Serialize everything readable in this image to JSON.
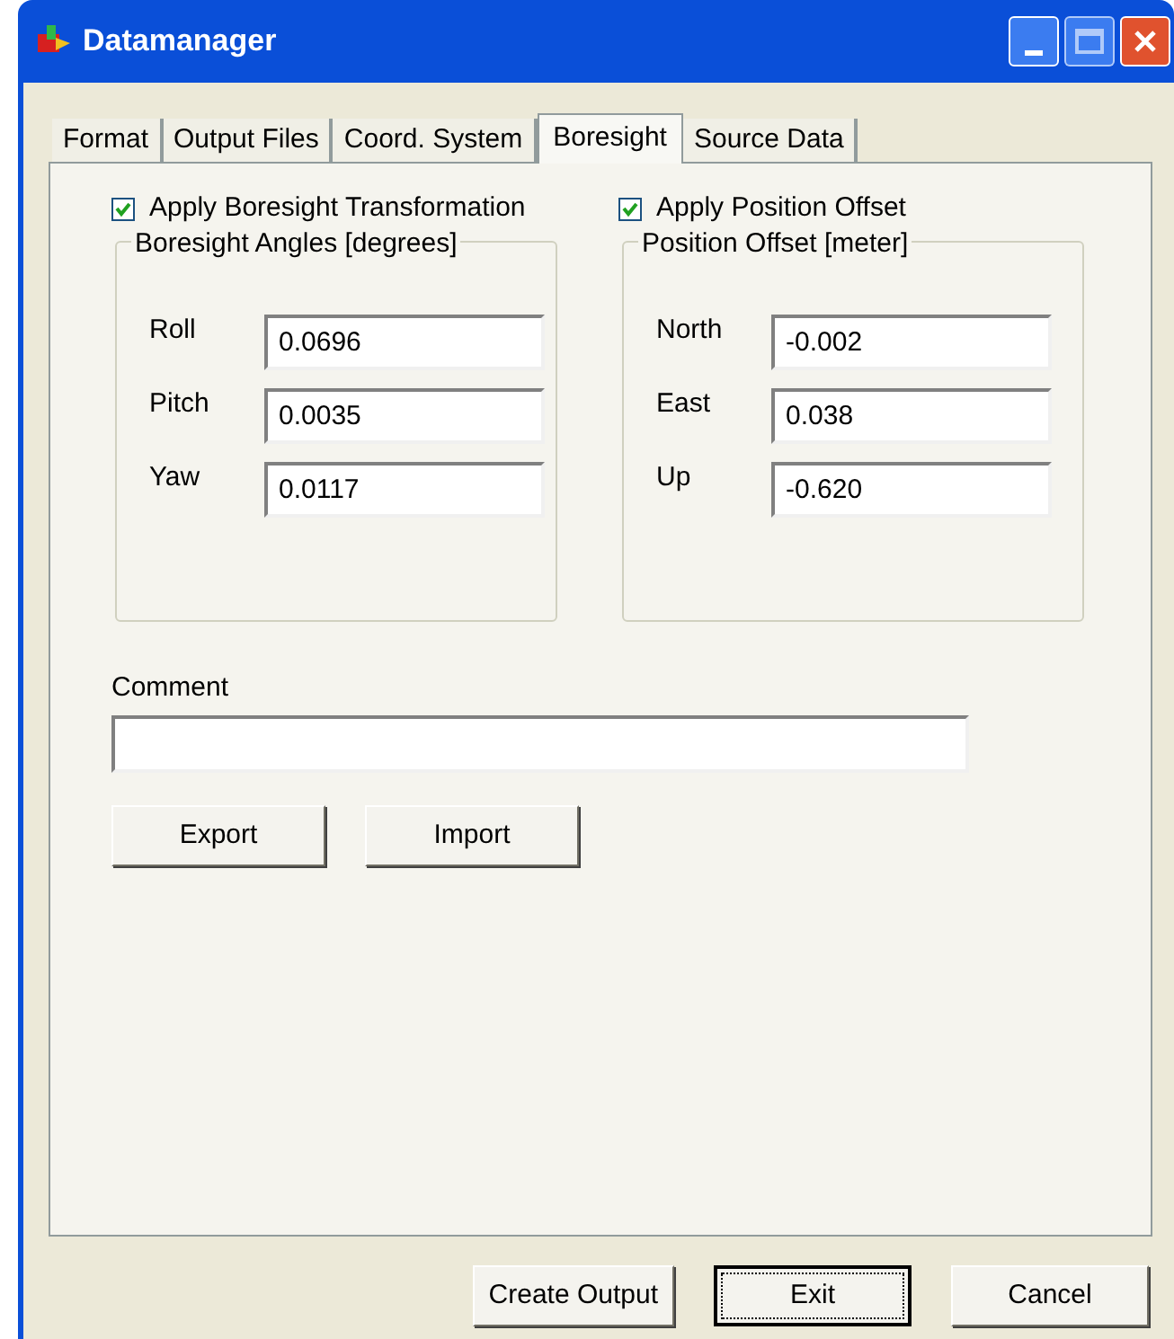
{
  "window": {
    "title": "Datamanager"
  },
  "tabs": [
    {
      "label": "Format",
      "selected": false
    },
    {
      "label": "Output Files",
      "selected": false
    },
    {
      "label": "Coord. System",
      "selected": false
    },
    {
      "label": "Boresight",
      "selected": true
    },
    {
      "label": "Source Data",
      "selected": false
    }
  ],
  "checkboxes": [
    {
      "label": "Apply Boresight Transformation",
      "checked": true
    },
    {
      "label": "Apply Position Offset",
      "checked": true
    }
  ],
  "groups": [
    {
      "title": "Boresight Angles [degrees]",
      "fields": [
        {
          "label": "Roll",
          "value": "0.0696"
        },
        {
          "label": "Pitch",
          "value": "0.0035"
        },
        {
          "label": "Yaw",
          "value": "0.0117"
        }
      ]
    },
    {
      "title": "Position Offset [meter]",
      "fields": [
        {
          "label": "North",
          "value": "-0.002"
        },
        {
          "label": "East",
          "value": "0.038"
        },
        {
          "label": "Up",
          "value": "-0.620"
        }
      ]
    }
  ],
  "comment": {
    "label": "Comment"
  },
  "panel_buttons": [
    "Export",
    "Import"
  ],
  "buttons": [
    {
      "label": "Create Output",
      "focused": false
    },
    {
      "label": "Exit",
      "focused": true
    },
    {
      "label": "Cancel",
      "focused": false
    }
  ]
}
